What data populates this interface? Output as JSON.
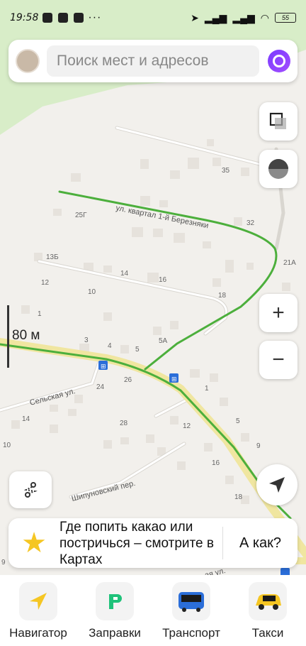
{
  "status_bar": {
    "time": "19:58",
    "more": "···",
    "battery": "55"
  },
  "search": {
    "placeholder": "Поиск мест и адресов"
  },
  "map": {
    "streets": {
      "kvartal": "ул. квартал 1-й Березняки",
      "selskaya": "Сельская ул.",
      "shipunovsky": "Шипуновский пер.",
      "partial": "ая ул."
    },
    "house_numbers": {
      "h35": "35",
      "h25g": "25Г",
      "h32": "32",
      "h13b": "13Б",
      "h14a": "14",
      "h16a": "16",
      "h21a": "21А",
      "h12a": "12",
      "h10a": "10",
      "h18a": "18",
      "h1a": "1",
      "h3": "3",
      "h4": "4",
      "h5": "5",
      "h5a": "5А",
      "h24": "24",
      "h26": "26",
      "h1b": "1",
      "h14b": "14",
      "h28": "28",
      "h12b": "12",
      "h5b": "5",
      "h10b": "10",
      "h9": "9",
      "h16b": "16",
      "h18b": "18",
      "h9b": "9"
    },
    "scale": "80 м",
    "colors": {
      "route": "#4caf3c",
      "main_road": "#f0e6a0",
      "park": "#d8edc8",
      "bus_stop": "#2b6ed9"
    }
  },
  "controls": {
    "zoom_in": "+",
    "zoom_out": "−"
  },
  "promo": {
    "text": "Где попить какао или постричься – смотрите в Картах",
    "action": "А как?"
  },
  "tabs": [
    {
      "label": "Навигатор",
      "icon": "navigator-icon"
    },
    {
      "label": "Заправки",
      "icon": "fuel-icon"
    },
    {
      "label": "Транспорт",
      "icon": "bus-icon"
    },
    {
      "label": "Такси",
      "icon": "taxi-icon"
    }
  ]
}
